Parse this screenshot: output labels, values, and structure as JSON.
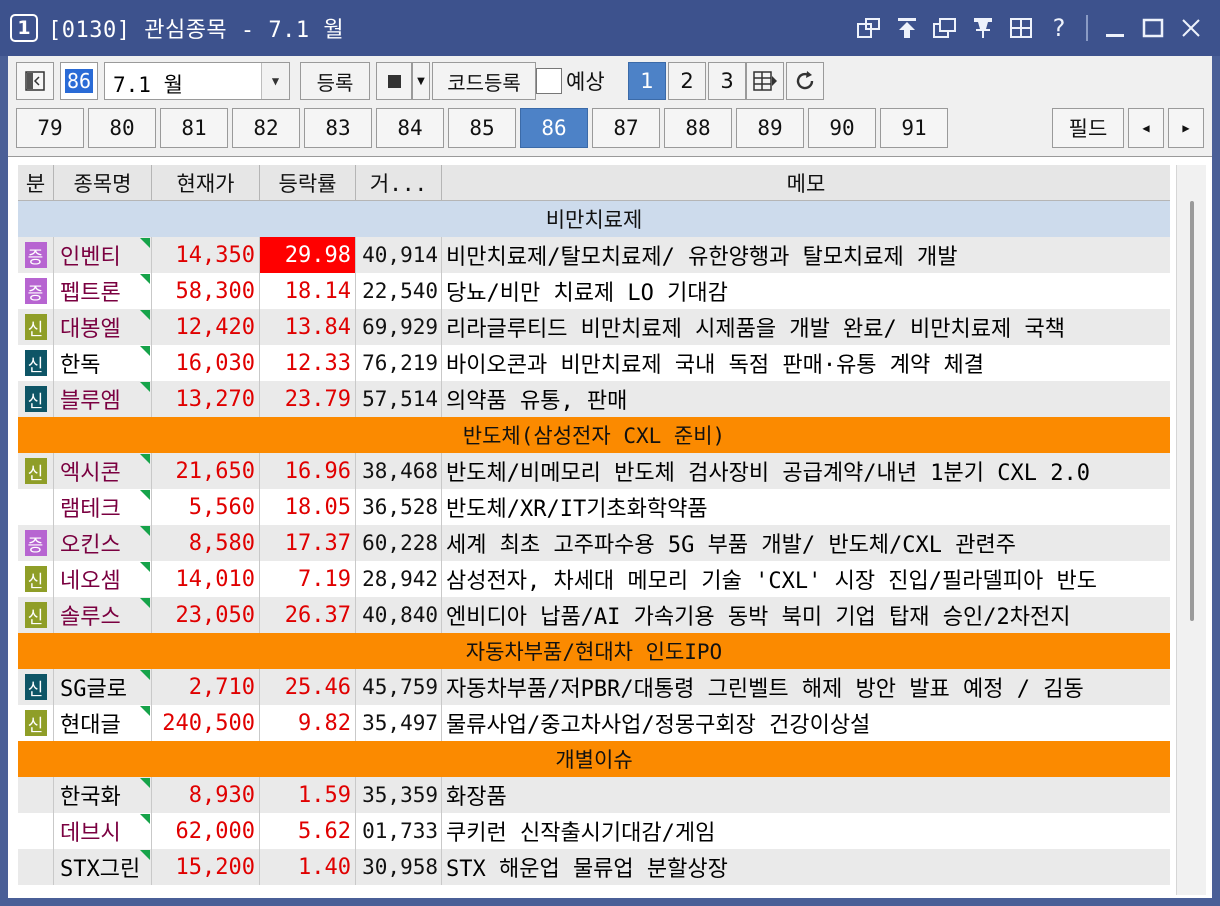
{
  "titlebar": {
    "screen_num": "1",
    "title": "[0130] 관심종목 - 7.1 월",
    "icons": [
      "link-window-icon",
      "pin-top-icon",
      "copy-window-icon",
      "pin-icon",
      "grid-icon",
      "help-icon",
      "minimize-icon",
      "maximize-icon",
      "close-icon"
    ],
    "help_glyph": "?"
  },
  "toolbar": {
    "group_number": "86",
    "group_name": "7.1 월",
    "register_label": "등록",
    "code_register_label": "코드등록",
    "forecast_label": "예상",
    "pages": [
      "1",
      "2",
      "3"
    ],
    "active_page": "1"
  },
  "group_tabs": {
    "items": [
      "79",
      "80",
      "81",
      "82",
      "83",
      "84",
      "85",
      "86",
      "87",
      "88",
      "89",
      "90",
      "91"
    ],
    "active": "86",
    "field_label": "필드"
  },
  "grid": {
    "headers": {
      "division": "분",
      "name": "종목명",
      "price": "현재가",
      "rate": "등락률",
      "volume": "거...",
      "memo": "메모"
    },
    "groups": [
      {
        "title": "비만치료제",
        "color": "#cddbec",
        "rows": [
          {
            "badge": "증",
            "name": "인벤티",
            "price": "14,350",
            "rate": "29.98",
            "volume": "40,914",
            "memo": "비만치료제/탈모치료제/ 유한양행과 탈모치료제 개발",
            "hot": true
          },
          {
            "badge": "증",
            "name": "펩트론",
            "price": "58,300",
            "rate": "18.14",
            "volume": "22,540",
            "memo": "당뇨/비만 치료제 LO 기대감"
          },
          {
            "badge": "신",
            "name": "대봉엘",
            "price": "12,420",
            "rate": "13.84",
            "volume": "69,929",
            "memo": "리라글루티드 비만치료제 시제품을 개발 완료/ 비만치료제 국책"
          },
          {
            "badge": "신2",
            "name": "한독",
            "price": "16,030",
            "rate": "12.33",
            "volume": "76,219",
            "memo": "바이오콘과 비만치료제 국내 독점 판매·유통 계약 체결",
            "plain": true
          },
          {
            "badge": "신2",
            "name": "블루엠",
            "price": "13,270",
            "rate": "23.79",
            "volume": "57,514",
            "memo": "의약품 유통, 판매"
          }
        ]
      },
      {
        "title": "반도체(삼성전자 CXL 준비)",
        "color": "#fb8a00",
        "rows": [
          {
            "badge": "신",
            "name": "엑시콘",
            "price": "21,650",
            "rate": "16.96",
            "volume": "38,468",
            "memo": "반도체/비메모리 반도체 검사장비 공급계약/내년 1분기 CXL 2.0"
          },
          {
            "badge": "",
            "name": "램테크",
            "price": "5,560",
            "rate": "18.05",
            "volume": "36,528",
            "memo": "반도체/XR/IT기초화학약품"
          },
          {
            "badge": "증",
            "name": "오킨스",
            "price": "8,580",
            "rate": "17.37",
            "volume": "60,228",
            "memo": "세계 최초 고주파수용 5G 부품 개발/ 반도체/CXL 관련주"
          },
          {
            "badge": "신",
            "name": "네오셈",
            "price": "14,010",
            "rate": "7.19",
            "volume": "28,942",
            "memo": "삼성전자, 차세대 메모리 기술 'CXL' 시장 진입/필라델피아 반도"
          },
          {
            "badge": "신",
            "name": "솔루스",
            "price": "23,050",
            "rate": "26.37",
            "volume": "40,840",
            "memo": "엔비디아 납품/AI 가속기용 동박 북미 기업 탑재 승인/2차전지"
          }
        ]
      },
      {
        "title": "자동차부품/현대차 인도IPO",
        "color": "#fb8a00",
        "rows": [
          {
            "badge": "신2",
            "name": "SG글로",
            "price": "2,710",
            "rate": "25.46",
            "volume": "45,759",
            "memo": "자동차부품/저PBR/대통령 그린벨트 해제 방안 발표 예정 / 김동",
            "plain": true
          },
          {
            "badge": "신",
            "name": "현대글",
            "price": "240,500",
            "rate": "9.82",
            "volume": "35,497",
            "memo": "물류사업/중고차사업/정몽구회장 건강이상설",
            "plain": true
          }
        ]
      },
      {
        "title": "개별이슈",
        "color": "#fb8a00",
        "rows": [
          {
            "badge": "",
            "name": "한국화",
            "price": "8,930",
            "rate": "1.59",
            "volume": "35,359",
            "memo": "화장품",
            "plain": true
          },
          {
            "badge": "",
            "name": "데브시",
            "price": "62,000",
            "rate": "5.62",
            "volume": "01,733",
            "memo": "쿠키런 신작출시기대감/게임"
          },
          {
            "badge": "",
            "name": "STX그린",
            "price": "15,200",
            "rate": "1.40",
            "volume": "30,958",
            "memo": "STX 해운업 물류업 분할상장",
            "plain": true
          }
        ]
      }
    ]
  }
}
